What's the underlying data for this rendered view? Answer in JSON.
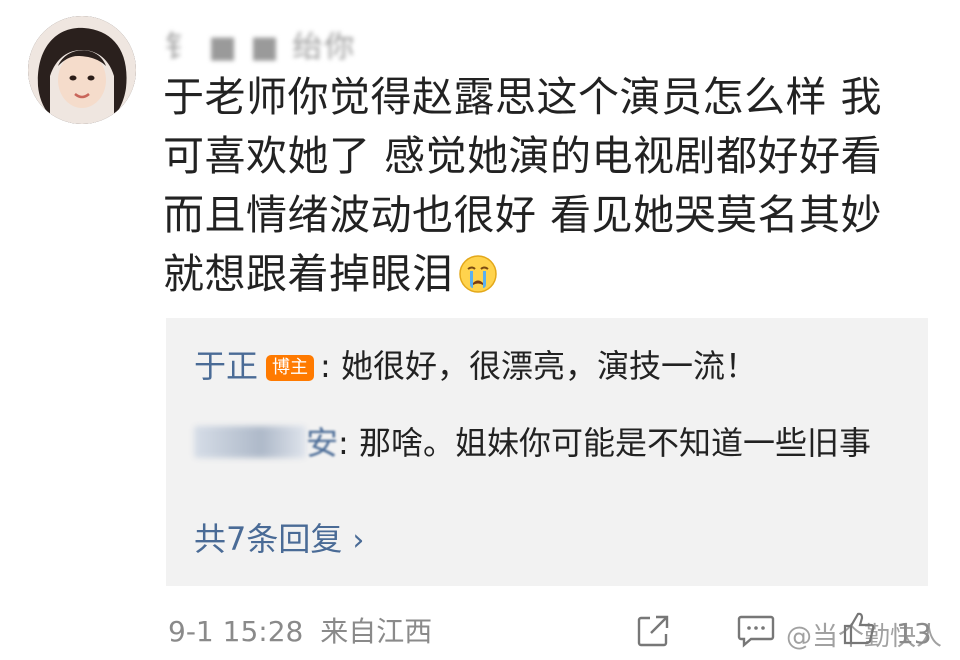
{
  "comment": {
    "username": "钅 ■ ■ 绐你",
    "text": "于老师你觉得赵露思这个演员怎么样 我可喜欢她了 感觉她演的电视剧都好好看 而且情绪波动也很好 看见她哭莫名其妙就想跟着掉眼泪",
    "emoji_icon": "crying-face-icon",
    "avatar_icon": "user-avatar-photo"
  },
  "replies": {
    "items": [
      {
        "name": "于正",
        "badge": "博主",
        "text": "她很好，很漂亮，演技一流！"
      },
      {
        "name_tail": "安",
        "text": "那啥。姐妹你可能是不知道一些旧事"
      }
    ],
    "more_label": "共7条回复",
    "more_icon": "chevron-right-icon"
  },
  "footer": {
    "timestamp": "9-1 15:28",
    "source": "来自江西",
    "share_icon": "share-icon",
    "comment_icon": "comment-icon",
    "like_icon": "like-icon",
    "like_count": "13",
    "watermark": "@当个勤快人"
  },
  "colors": {
    "link": "#4a6b96",
    "badge": "#ff7a00",
    "reply_bg": "#f2f2f2",
    "meta": "#8a8a8a"
  }
}
